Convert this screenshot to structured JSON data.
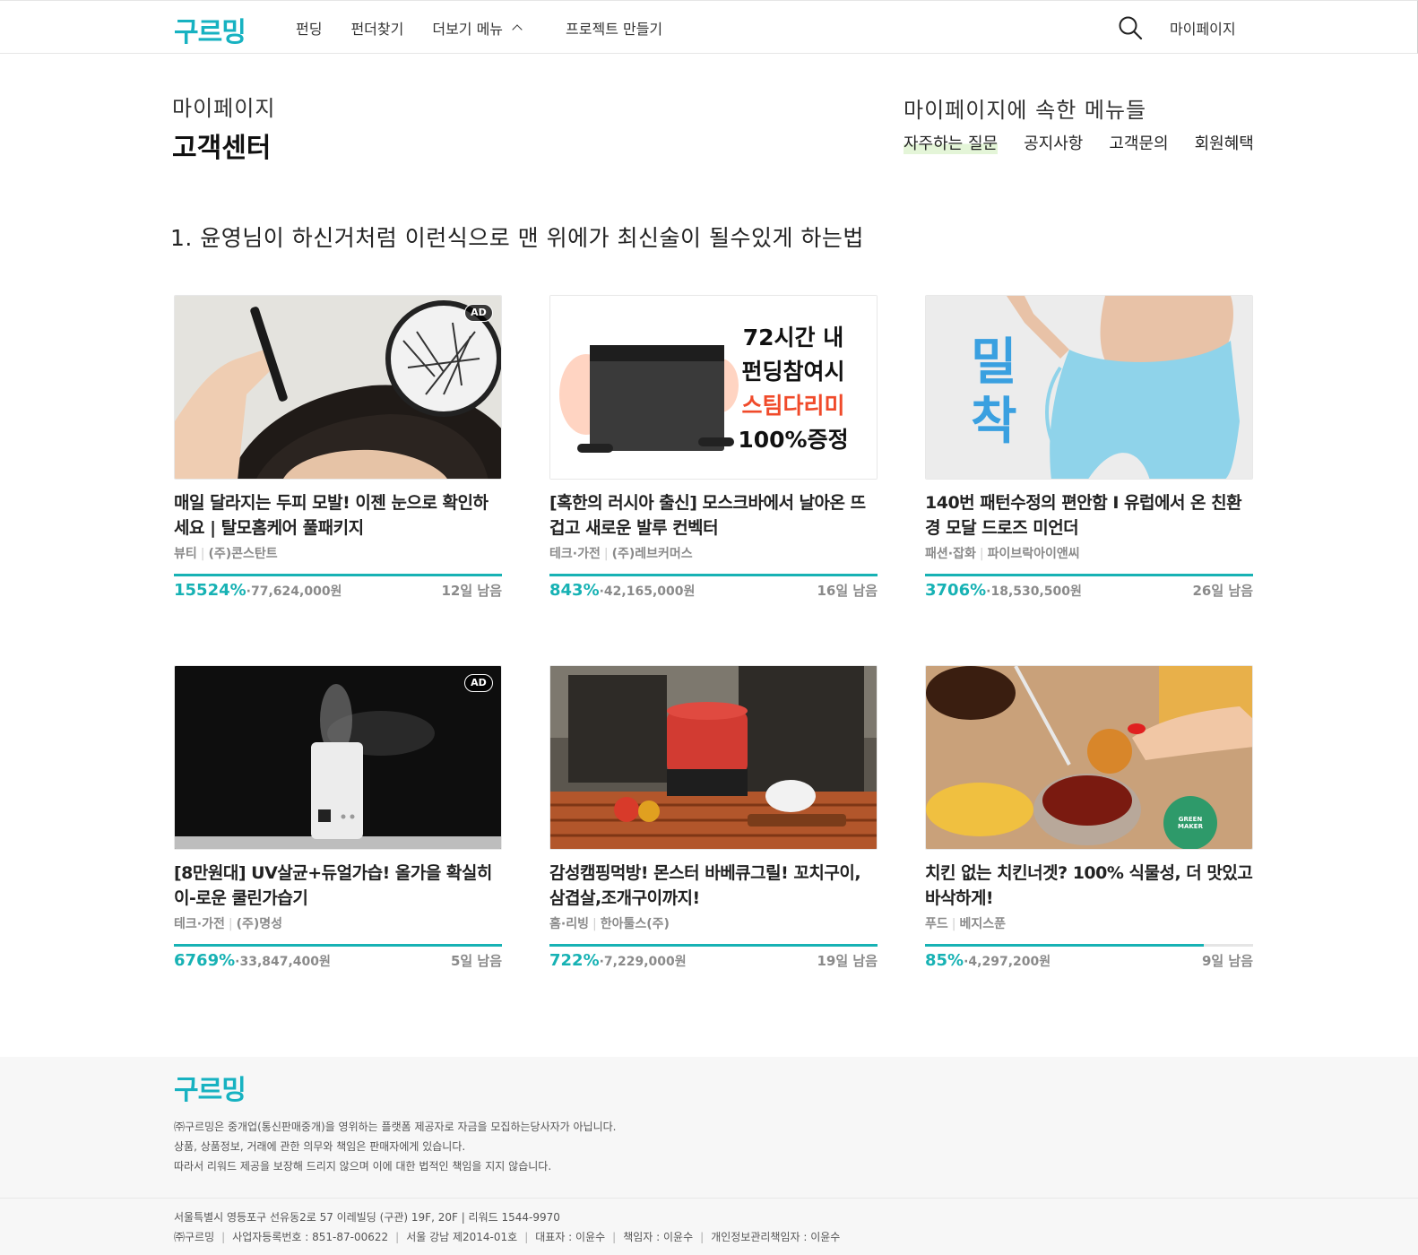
{
  "header": {
    "logo": "구르밍",
    "nav": [
      "펀딩",
      "펀더찾기",
      "더보기 메뉴",
      "프로젝트 만들기"
    ],
    "mypage": "마이페이지"
  },
  "page": {
    "breadcrumb": "마이페이지",
    "title": "고객센터",
    "side_title": "마이페이지에 속한 메뉴들",
    "side_menu": [
      "자주하는 질문",
      "공지사항",
      "고객문의",
      "회원혜택"
    ],
    "section_title": "1. 윤영님이 하신거처럼 이런식으로 맨 위에가 최신술이 될수있게 하는법"
  },
  "cards": [
    {
      "title": "매일 달라지는 두피 모발! 이젠 눈으로 확인하세요 | 탈모홈케어 풀패키지",
      "category": "뷰티",
      "company": "(주)콘스탄트",
      "percent": "15524%",
      "amount": "·77,624,000원",
      "days": "12일 남음",
      "ad": "AD",
      "progress": 1.0
    },
    {
      "title": "[혹한의 러시아 출신] 모스크바에서 날아온 뜨겁고 새로운 발루 컨벡터",
      "category": "테크·가전",
      "company": "(주)레브커머스",
      "percent": "843%",
      "amount": "·42,165,000원",
      "days": "16일 남음",
      "ad": "",
      "progress": 1.0,
      "image_text": [
        "72시간 내",
        "펀딩참여시",
        "스팀다리미",
        "100%증정"
      ]
    },
    {
      "title": "140번 패턴수정의 편안함 I 유럽에서 온 친환경 모달 드로즈 미언더",
      "category": "패션·잡화",
      "company": "파이브락아이앤씨",
      "percent": "3706%",
      "amount": "·18,530,500원",
      "days": "26일 남음",
      "ad": "",
      "progress": 1.0,
      "image_text": [
        "밀",
        "착"
      ]
    },
    {
      "title": "[8만원대] UV살균+듀얼가습! 올가을 확실히 이-로운 쿨린가습기",
      "category": "테크·가전",
      "company": "(주)명성",
      "percent": "6769%",
      "amount": "·33,847,400원",
      "days": "5일 남음",
      "ad": "AD",
      "progress": 1.0
    },
    {
      "title": "감성캠핑먹방! 몬스터 바베큐그릴! 꼬치구이, 삼겹살,조개구이까지!",
      "category": "홈·리빙",
      "company": "한아툴스(주)",
      "percent": "722%",
      "amount": "·7,229,000원",
      "days": "19일 남음",
      "ad": "",
      "progress": 1.0
    },
    {
      "title": "치킨 없는 치킨너겟? 100% 식물성, 더 맛있고 바삭하게!",
      "category": "푸드",
      "company": "베지스푼",
      "percent": "85%",
      "amount": "·4,297,200원",
      "days": "9일 남음",
      "ad": "",
      "progress": 0.85,
      "image_text": [
        "GREEN MAKER"
      ]
    }
  ],
  "footer": {
    "logo": "구르밍",
    "notes": [
      "㈜구르밍은 중개업(통신판매중개)을 영위하는 플랫폼 제공자로 자금을 모집하는당사자가 아닙니다.",
      "상품, 상품정보, 거래에 관한 의무와 책임은 판매자에게 있습니다.",
      "따라서 리워드 제공을 보장해 드리지 않으며 이에 대한 법적인 책임을 지지 않습니다."
    ],
    "address": "서울특별시 영등포구 선유동2로 57 이레빌딩 (구관) 19F, 20F | 리워드 1544-9970",
    "info": [
      "㈜구르밍",
      "사업자등록번호 : 851-87-00622",
      "서울 강남 제2014-01호",
      "대표자 : 이윤수",
      "책임자 : 이윤수",
      "개인정보관리책임자 : 이윤수"
    ]
  },
  "colors": {
    "brand": "#17b2c1",
    "progress": "#17b2b4"
  }
}
